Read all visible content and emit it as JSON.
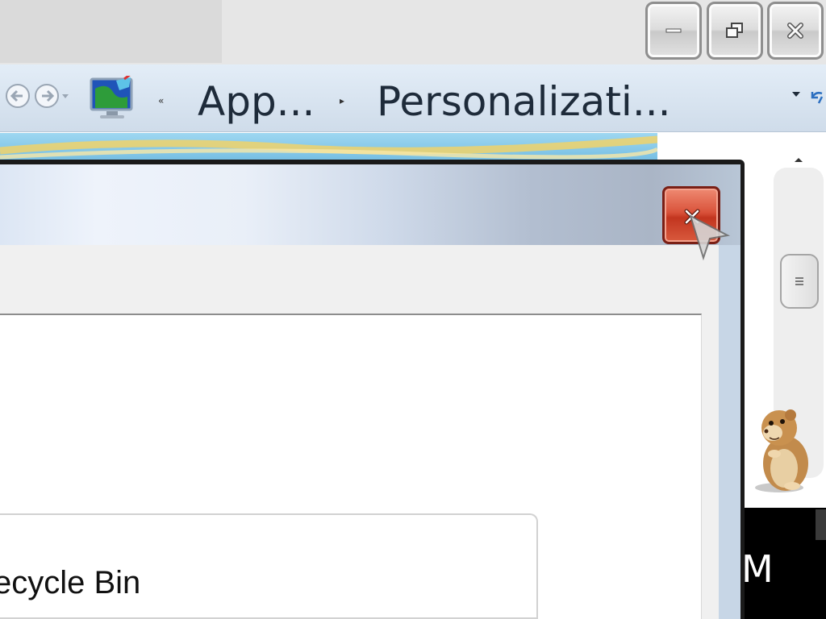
{
  "window": {
    "caption_buttons": [
      {
        "name": "minimize",
        "icon": "minimize-icon"
      },
      {
        "name": "restore",
        "icon": "restore-icon"
      },
      {
        "name": "close",
        "icon": "close-icon"
      }
    ]
  },
  "toolbar": {
    "back_icon": "back-arrow-icon",
    "forward_icon": "forward-arrow-icon",
    "location_icon": "control-panel-icon",
    "overflow_glyph": "«",
    "separator_glyph": "▸",
    "breadcrumbs": [
      {
        "label": "App..."
      },
      {
        "label": "Personalizati..."
      }
    ],
    "dropdown_icon": "chevron-down-icon",
    "refresh_icon": "refresh-icon"
  },
  "dialog": {
    "close_icon": "close-icon",
    "list_items": [
      "ecycle Bin"
    ]
  },
  "taskbar": {
    "partial_text": "M"
  },
  "colors": {
    "close_red": "#d24a32",
    "toolbar_blue": "#dbe6f2",
    "banner_blue": "#8fd0ee"
  }
}
